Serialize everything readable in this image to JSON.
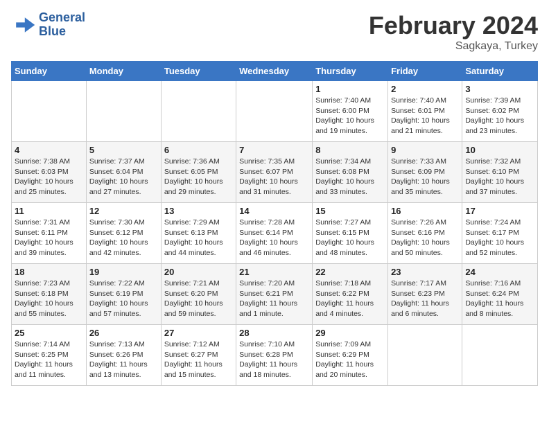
{
  "header": {
    "logo_line1": "General",
    "logo_line2": "Blue",
    "title": "February 2024",
    "subtitle": "Sagkaya, Turkey"
  },
  "weekdays": [
    "Sunday",
    "Monday",
    "Tuesday",
    "Wednesday",
    "Thursday",
    "Friday",
    "Saturday"
  ],
  "weeks": [
    [
      {
        "num": "",
        "info": ""
      },
      {
        "num": "",
        "info": ""
      },
      {
        "num": "",
        "info": ""
      },
      {
        "num": "",
        "info": ""
      },
      {
        "num": "1",
        "info": "Sunrise: 7:40 AM\nSunset: 6:00 PM\nDaylight: 10 hours\nand 19 minutes."
      },
      {
        "num": "2",
        "info": "Sunrise: 7:40 AM\nSunset: 6:01 PM\nDaylight: 10 hours\nand 21 minutes."
      },
      {
        "num": "3",
        "info": "Sunrise: 7:39 AM\nSunset: 6:02 PM\nDaylight: 10 hours\nand 23 minutes."
      }
    ],
    [
      {
        "num": "4",
        "info": "Sunrise: 7:38 AM\nSunset: 6:03 PM\nDaylight: 10 hours\nand 25 minutes."
      },
      {
        "num": "5",
        "info": "Sunrise: 7:37 AM\nSunset: 6:04 PM\nDaylight: 10 hours\nand 27 minutes."
      },
      {
        "num": "6",
        "info": "Sunrise: 7:36 AM\nSunset: 6:05 PM\nDaylight: 10 hours\nand 29 minutes."
      },
      {
        "num": "7",
        "info": "Sunrise: 7:35 AM\nSunset: 6:07 PM\nDaylight: 10 hours\nand 31 minutes."
      },
      {
        "num": "8",
        "info": "Sunrise: 7:34 AM\nSunset: 6:08 PM\nDaylight: 10 hours\nand 33 minutes."
      },
      {
        "num": "9",
        "info": "Sunrise: 7:33 AM\nSunset: 6:09 PM\nDaylight: 10 hours\nand 35 minutes."
      },
      {
        "num": "10",
        "info": "Sunrise: 7:32 AM\nSunset: 6:10 PM\nDaylight: 10 hours\nand 37 minutes."
      }
    ],
    [
      {
        "num": "11",
        "info": "Sunrise: 7:31 AM\nSunset: 6:11 PM\nDaylight: 10 hours\nand 39 minutes."
      },
      {
        "num": "12",
        "info": "Sunrise: 7:30 AM\nSunset: 6:12 PM\nDaylight: 10 hours\nand 42 minutes."
      },
      {
        "num": "13",
        "info": "Sunrise: 7:29 AM\nSunset: 6:13 PM\nDaylight: 10 hours\nand 44 minutes."
      },
      {
        "num": "14",
        "info": "Sunrise: 7:28 AM\nSunset: 6:14 PM\nDaylight: 10 hours\nand 46 minutes."
      },
      {
        "num": "15",
        "info": "Sunrise: 7:27 AM\nSunset: 6:15 PM\nDaylight: 10 hours\nand 48 minutes."
      },
      {
        "num": "16",
        "info": "Sunrise: 7:26 AM\nSunset: 6:16 PM\nDaylight: 10 hours\nand 50 minutes."
      },
      {
        "num": "17",
        "info": "Sunrise: 7:24 AM\nSunset: 6:17 PM\nDaylight: 10 hours\nand 52 minutes."
      }
    ],
    [
      {
        "num": "18",
        "info": "Sunrise: 7:23 AM\nSunset: 6:18 PM\nDaylight: 10 hours\nand 55 minutes."
      },
      {
        "num": "19",
        "info": "Sunrise: 7:22 AM\nSunset: 6:19 PM\nDaylight: 10 hours\nand 57 minutes."
      },
      {
        "num": "20",
        "info": "Sunrise: 7:21 AM\nSunset: 6:20 PM\nDaylight: 10 hours\nand 59 minutes."
      },
      {
        "num": "21",
        "info": "Sunrise: 7:20 AM\nSunset: 6:21 PM\nDaylight: 11 hours\nand 1 minute."
      },
      {
        "num": "22",
        "info": "Sunrise: 7:18 AM\nSunset: 6:22 PM\nDaylight: 11 hours\nand 4 minutes."
      },
      {
        "num": "23",
        "info": "Sunrise: 7:17 AM\nSunset: 6:23 PM\nDaylight: 11 hours\nand 6 minutes."
      },
      {
        "num": "24",
        "info": "Sunrise: 7:16 AM\nSunset: 6:24 PM\nDaylight: 11 hours\nand 8 minutes."
      }
    ],
    [
      {
        "num": "25",
        "info": "Sunrise: 7:14 AM\nSunset: 6:25 PM\nDaylight: 11 hours\nand 11 minutes."
      },
      {
        "num": "26",
        "info": "Sunrise: 7:13 AM\nSunset: 6:26 PM\nDaylight: 11 hours\nand 13 minutes."
      },
      {
        "num": "27",
        "info": "Sunrise: 7:12 AM\nSunset: 6:27 PM\nDaylight: 11 hours\nand 15 minutes."
      },
      {
        "num": "28",
        "info": "Sunrise: 7:10 AM\nSunset: 6:28 PM\nDaylight: 11 hours\nand 18 minutes."
      },
      {
        "num": "29",
        "info": "Sunrise: 7:09 AM\nSunset: 6:29 PM\nDaylight: 11 hours\nand 20 minutes."
      },
      {
        "num": "",
        "info": ""
      },
      {
        "num": "",
        "info": ""
      }
    ]
  ]
}
